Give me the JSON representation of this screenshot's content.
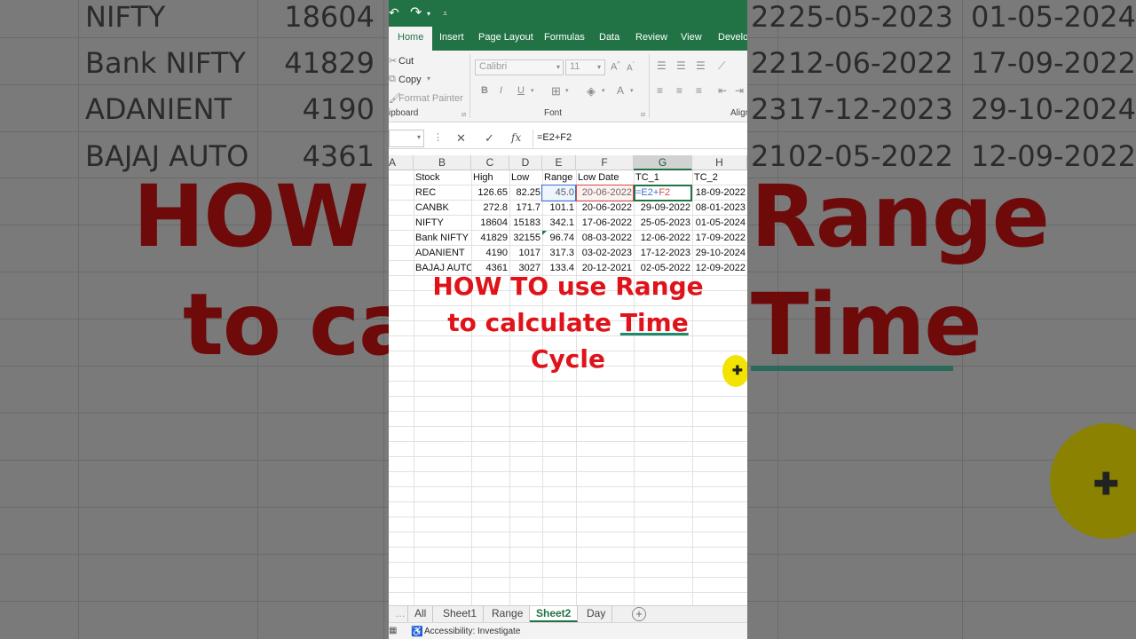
{
  "background": {
    "rows": [
      {
        "name": "NIFTY",
        "value": "18604",
        "d1": "25-05-2023",
        "d2": "01-05-2024",
        "lead": "22"
      },
      {
        "name": "Bank NIFTY",
        "value": "41829",
        "d1": "12-06-2022",
        "d2": "17-09-2022",
        "lead": "22"
      },
      {
        "name": "ADANIENT",
        "value": "4190",
        "d1": "17-12-2023",
        "d2": "29-10-2024",
        "lead": "23"
      },
      {
        "name": "BAJAJ AUTO",
        "value": "4361",
        "d1": "02-05-2022",
        "d2": "12-09-2022",
        "lead": "21"
      }
    ],
    "title_line1_left": "HOW T",
    "title_line1_right": "Range",
    "title_line2_left": "to ca",
    "title_line2_right": "Time"
  },
  "quick_access": {
    "redo_icon": "redo-icon",
    "customize_icon": "customize-icon"
  },
  "ribbon_tabs": [
    "Home",
    "Insert",
    "Page Layout",
    "Formulas",
    "Data",
    "Review",
    "View",
    "Develo"
  ],
  "active_tab": "Home",
  "clipboard": {
    "cut": "Cut",
    "copy": "Copy",
    "format_painter": "Format Painter",
    "group": "ipboard"
  },
  "font": {
    "name": "Calibri",
    "size": "11",
    "group": "Font",
    "bold": "B",
    "italic": "I",
    "underline": "U"
  },
  "alignment": {
    "group": "Align"
  },
  "formula_bar": {
    "formula": "=E2+F2",
    "cancel": "✕",
    "enter": "✓",
    "fx": "fx"
  },
  "columns": [
    "A",
    "B",
    "C",
    "D",
    "E",
    "F",
    "G",
    "H"
  ],
  "selected_column": "G",
  "headers": [
    "Stock",
    "High",
    "Low",
    "Range",
    "Low Date",
    "TC_1",
    "TC_2"
  ],
  "rows": [
    {
      "stock": "REC",
      "high": "126.65",
      "low": "82.25",
      "range": "45.0",
      "low_date": "20-06-2022",
      "tc1": "=E2+F2",
      "tc2": "18-09-2022"
    },
    {
      "stock": "CANBK",
      "high": "272.8",
      "low": "171.7",
      "range": "101.1",
      "low_date": "20-06-2022",
      "tc1": "29-09-2022",
      "tc2": "08-01-2023"
    },
    {
      "stock": "NIFTY",
      "high": "18604",
      "low": "15183",
      "range": "342.1",
      "low_date": "17-06-2022",
      "tc1": "25-05-2023",
      "tc2": "01-05-2024"
    },
    {
      "stock": "Bank NIFTY",
      "high": "41829",
      "low": "32155",
      "range": "96.74",
      "low_date": "08-03-2022",
      "tc1": "12-06-2022",
      "tc2": "17-09-2022"
    },
    {
      "stock": "ADANIENT",
      "high": "4190",
      "low": "1017",
      "range": "317.3",
      "low_date": "03-02-2023",
      "tc1": "17-12-2023",
      "tc2": "29-10-2024"
    },
    {
      "stock": "BAJAJ AUTO",
      "high": "4361",
      "low": "3027",
      "range": "133.4",
      "low_date": "20-12-2021",
      "tc1": "02-05-2022",
      "tc2": "12-09-2022"
    }
  ],
  "overlay": {
    "line1": "HOW TO use Range",
    "line2_a": "to calculate ",
    "line2_b": "Time",
    "line3": "Cycle"
  },
  "sheet_tabs": [
    "All",
    "Sheet1",
    "Range",
    "Sheet2",
    "Day"
  ],
  "active_sheet": "Sheet2",
  "status": {
    "accessibility": "Accessibility: Investigate"
  },
  "colors": {
    "excel_green": "#217346",
    "title_red": "#e0121a",
    "cursor_yellow": "#f2e400"
  }
}
